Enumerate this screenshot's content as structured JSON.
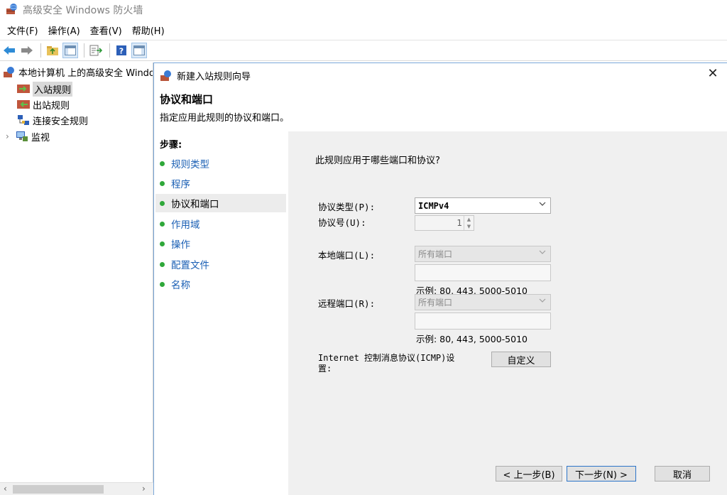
{
  "window": {
    "title": "高级安全 Windows 防火墙"
  },
  "menu": {
    "items": [
      "文件(F)",
      "操作(A)",
      "查看(V)",
      "帮助(H)"
    ]
  },
  "tree": {
    "root": "本地计算机 上的高级安全 Windows",
    "items": [
      {
        "label": "入站规则",
        "selected": true
      },
      {
        "label": "出站规则",
        "selected": false
      },
      {
        "label": "连接安全规则",
        "selected": false
      },
      {
        "label": "监视",
        "selected": false
      }
    ]
  },
  "dialog": {
    "title": "新建入站规则向导",
    "heading": "协议和端口",
    "subtitle": "指定应用此规则的协议和端口。",
    "steps_title": "步骤:",
    "steps": [
      "规则类型",
      "程序",
      "协议和端口",
      "作用域",
      "操作",
      "配置文件",
      "名称"
    ],
    "active_step": 2,
    "question": "此规则应用于哪些端口和协议?",
    "protocol_type_label": "协议类型(P):",
    "protocol_type_value": "ICMPv4",
    "protocol_number_label": "协议号(U):",
    "protocol_number_value": "1",
    "local_port_label": "本地端口(L):",
    "local_port_value": "所有端口",
    "local_port_example": "示例: 80, 443, 5000-5010",
    "remote_port_label": "远程端口(R):",
    "remote_port_value": "所有端口",
    "remote_port_example": "示例: 80, 443, 5000-5010",
    "icmp_label_line1": "Internet 控制消息协议(ICMP)设",
    "icmp_label_line2": "置:",
    "customize_button": "自定义",
    "back_button": "< 上一步(B)",
    "next_button": "下一步(N) >",
    "cancel_button": "取消"
  },
  "colors": {
    "accent": "#1a5fb4",
    "step_dot": "#2fa83a",
    "content_bg": "#f0f0f0"
  }
}
